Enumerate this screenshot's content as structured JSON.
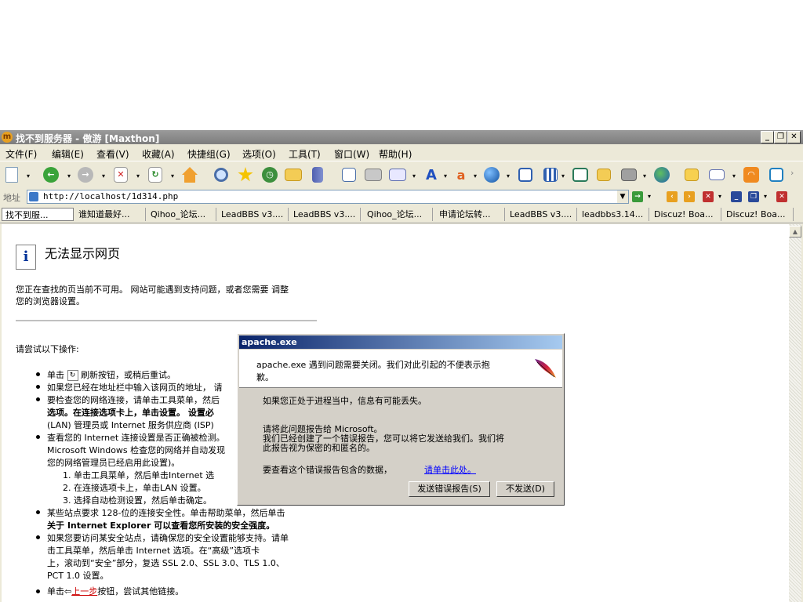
{
  "window": {
    "title": "找不到服务器 - 傲游 [Maxthon]",
    "app_icon": "m",
    "buttons": [
      "_",
      "❐",
      "✕"
    ]
  },
  "menu": [
    "文件(F)",
    "编辑(E)",
    "查看(V)",
    "收藏(A)",
    "快捷组(G)",
    "选项(O)",
    "工具(T)",
    "窗口(W)",
    "帮助(H)"
  ],
  "address": {
    "label": "地址",
    "url": "http://localhost/1d314.php"
  },
  "tabs": [
    "找不到服...",
    "谁知道最好...",
    "Qihoo_论坛...",
    "LeadBBS v3....",
    "LeadBBS v3....",
    "Qihoo_论坛...",
    "申请论坛转...",
    "LeadBBS v3....",
    "leadbbs3.14...",
    "Discuz! Boa...",
    "Discuz! Boa..."
  ],
  "page": {
    "heading": "无法显示网页",
    "intro_line1": "您正在查找的页当前不可用。 网站可能遇到支持问题，或者您需要 调整",
    "intro_line2": "您的浏览器设置。",
    "try_label": "请尝试以下操作:",
    "b1_pre": "单击",
    "b1_post": "刷新按钮，或稍后重试。",
    "b2": "如果您已经在地址栏中输入该网页的地址， 请",
    "b3_l1": "要检查您的网络连接，请单击工具菜单，然后",
    "b3_l2": "选项。在连接选项卡上，单击设置。 设置必",
    "b3_l3": "(LAN) 管理员或 Internet 服务供应商 (ISP)",
    "b4_l1": "查看您的 Internet 连接设置是否正确被检测。",
    "b4_l2": "Microsoft Windows 检查您的网络并自动发现",
    "b4_l3": "您的网络管理员已经启用此设置)。",
    "s1": "1.  单击工具菜单，然后单击Internet 选",
    "s2": "2.  在连接选项卡上，单击LAN 设置。",
    "s3": "3.  选择自动检测设置，然后单击确定。",
    "b5_l1": "某些站点要求 128-位的连接安全性。单击帮助菜单，然后单击",
    "b5_l2": "关于 Internet Explorer 可以查看您所安装的安全强度。",
    "b6_l1": "如果您要访问某安全站点，请确保您的安全设置能够支持。请单",
    "b6_l2": "击工具菜单，然后单击 Internet 选项。在“高级”选项卡",
    "b6_l3": "上，滚动到“安全”部分，复选 SSL 2.0、SSL 3.0、TLS 1.0、",
    "b6_l4": "PCT 1.0 设置。",
    "b7_pre": "单击",
    "b7_link": "上一步",
    "b7_post": "按钮，尝试其他链接。"
  },
  "dialog": {
    "title": "apache.exe",
    "head_l1": "apache.exe 遇到问题需要关闭。我们对此引起的不便表示抱",
    "head_l2": "歉。",
    "p1": "如果您正处于进程当中，信息有可能丢失。",
    "p2_l1": "请将此问题报告给 Microsoft。",
    "p2_l2": "我们已经创建了一个错误报告，您可以将它发送给我们。我们将",
    "p2_l3": "此报告视为保密的和匿名的。",
    "p3": "要查看这个错误报告包含的数据，",
    "link": "请单击此处。",
    "send_button": "发送错误报告(S)",
    "dont_send_button": "不发送(D)"
  },
  "toolbar_icons": [
    "new-page-icon",
    "back-icon",
    "forward-icon",
    "stop-icon",
    "refresh-icon",
    "home-icon",
    "search-icon",
    "favorites-icon",
    "history-icon",
    "folder-icon",
    "books-icon",
    "list-icon",
    "print-icon",
    "mail-icon",
    "font-icon",
    "translate-icon",
    "globe-icon",
    "window-icon",
    "columns-icon",
    "popup-icon",
    "folder-lock-icon",
    "plugin-icon",
    "earth-icon",
    "open-folder-icon",
    "edit-icon",
    "rss-icon",
    "download-icon"
  ]
}
